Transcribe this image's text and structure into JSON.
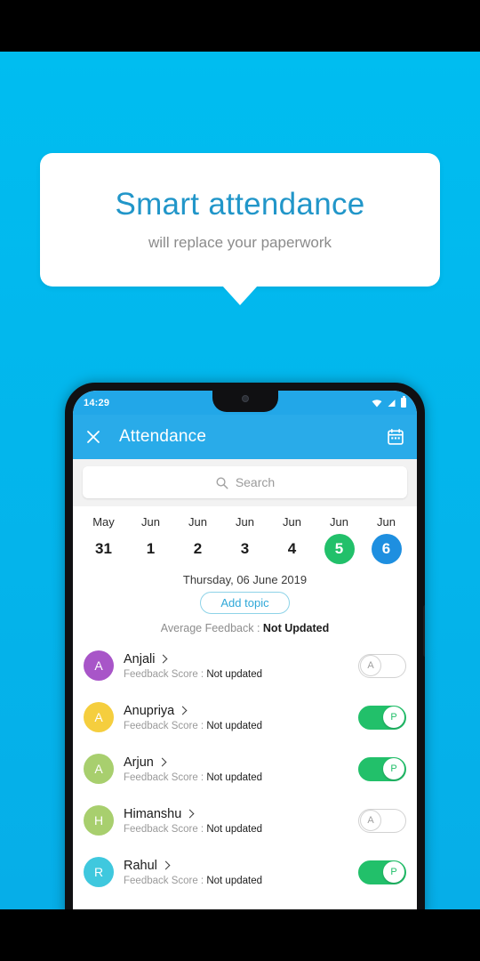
{
  "promo": {
    "headline": "Smart attendance",
    "subhead": "will replace your paperwork"
  },
  "colors": {
    "background": "#00BDF0",
    "appbar": "#29ABE9",
    "statusbar": "#22A7E8",
    "present_green": "#22C06A",
    "selected_blue": "#1E8FE0",
    "link_blue": "#2FA8D8"
  },
  "statusbar": {
    "time": "14:29",
    "icons": [
      "wifi-icon",
      "signal-icon",
      "battery-icon"
    ]
  },
  "appbar": {
    "close_icon": "close-icon",
    "title": "Attendance",
    "calendar_icon": "calendar-icon"
  },
  "search": {
    "icon": "search-icon",
    "placeholder": "Search",
    "value": ""
  },
  "dates": [
    {
      "month": "May",
      "day": "31",
      "state": "normal"
    },
    {
      "month": "Jun",
      "day": "1",
      "state": "normal"
    },
    {
      "month": "Jun",
      "day": "2",
      "state": "normal"
    },
    {
      "month": "Jun",
      "day": "3",
      "state": "normal"
    },
    {
      "month": "Jun",
      "day": "4",
      "state": "normal"
    },
    {
      "month": "Jun",
      "day": "5",
      "state": "green"
    },
    {
      "month": "Jun",
      "day": "6",
      "state": "blue"
    }
  ],
  "day_heading": "Thursday, 06 June 2019",
  "add_topic_label": "Add topic",
  "average_feedback": {
    "label": "Average Feedback : ",
    "value": "Not Updated"
  },
  "students": [
    {
      "name": "Anjali",
      "initial": "A",
      "avatar_color": "#A855C8",
      "feedback_label": "Feedback Score : ",
      "feedback_value": "Not updated",
      "attendance": "A",
      "present": false
    },
    {
      "name": "Anupriya",
      "initial": "A",
      "avatar_color": "#F5CE3E",
      "feedback_label": "Feedback Score : ",
      "feedback_value": "Not updated",
      "attendance": "P",
      "present": true
    },
    {
      "name": "Arjun",
      "initial": "A",
      "avatar_color": "#A8CF6E",
      "feedback_label": "Feedback Score : ",
      "feedback_value": "Not updated",
      "attendance": "P",
      "present": true
    },
    {
      "name": "Himanshu",
      "initial": "H",
      "avatar_color": "#A8CF6E",
      "feedback_label": "Feedback Score : ",
      "feedback_value": "Not updated",
      "attendance": "A",
      "present": false
    },
    {
      "name": "Rahul",
      "initial": "R",
      "avatar_color": "#3FC8DE",
      "feedback_label": "Feedback Score : ",
      "feedback_value": "Not updated",
      "attendance": "P",
      "present": true
    }
  ]
}
